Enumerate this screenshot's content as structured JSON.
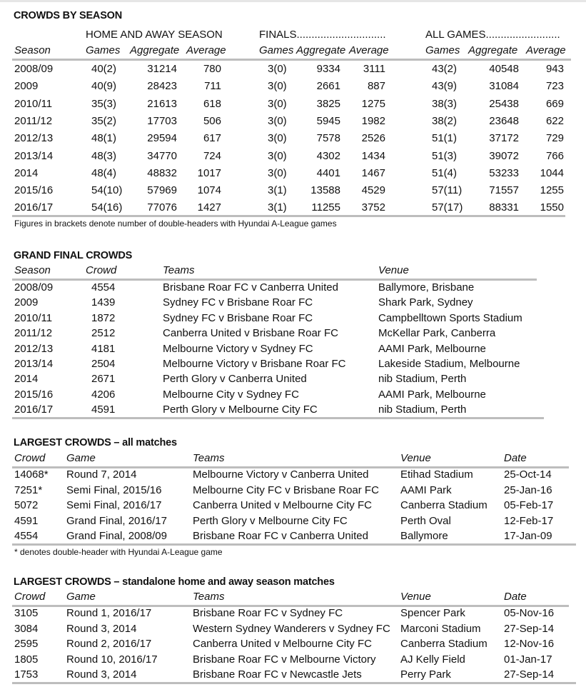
{
  "season": {
    "title": "CROWDS BY SEASON",
    "group_labels": {
      "home_away": "HOME AND AWAY SEASON",
      "finals": "FINALS..............................",
      "all_games": "ALL GAMES........................."
    },
    "headers": {
      "season": "Season",
      "ha_games": "Games",
      "ha_aggregate": "Aggregate",
      "ha_average": "Average",
      "f_games": "Games",
      "f_aggregate": "Aggregate",
      "f_average": "Average",
      "a_games": "Games",
      "a_aggregate": "Aggregate",
      "a_average": "Average"
    },
    "rows": [
      {
        "season": "2008/09",
        "ha_games": "40(2)",
        "ha_aggregate": "31214",
        "ha_average": "780",
        "f_games": "3(0)",
        "f_aggregate": "9334",
        "f_average": "3111",
        "a_games": "43(2)",
        "a_aggregate": "40548",
        "a_average": "943"
      },
      {
        "season": "2009",
        "ha_games": "40(9)",
        "ha_aggregate": "28423",
        "ha_average": "711",
        "f_games": "3(0)",
        "f_aggregate": "2661",
        "f_average": "887",
        "a_games": "43(9)",
        "a_aggregate": "31084",
        "a_average": "723"
      },
      {
        "season": "2010/11",
        "ha_games": "35(3)",
        "ha_aggregate": "21613",
        "ha_average": "618",
        "f_games": "3(0)",
        "f_aggregate": "3825",
        "f_average": "1275",
        "a_games": "38(3)",
        "a_aggregate": "25438",
        "a_average": "669"
      },
      {
        "season": "2011/12",
        "ha_games": "35(2)",
        "ha_aggregate": "17703",
        "ha_average": "506",
        "f_games": "3(0)",
        "f_aggregate": "5945",
        "f_average": "1982",
        "a_games": "38(2)",
        "a_aggregate": "23648",
        "a_average": "622"
      },
      {
        "season": "2012/13",
        "ha_games": "48(1)",
        "ha_aggregate": "29594",
        "ha_average": "617",
        "f_games": "3(0)",
        "f_aggregate": "7578",
        "f_average": "2526",
        "a_games": "51(1)",
        "a_aggregate": "37172",
        "a_average": "729"
      },
      {
        "season": "2013/14",
        "ha_games": "48(3)",
        "ha_aggregate": "34770",
        "ha_average": "724",
        "f_games": "3(0)",
        "f_aggregate": "4302",
        "f_average": "1434",
        "a_games": "51(3)",
        "a_aggregate": "39072",
        "a_average": "766"
      },
      {
        "season": "2014",
        "ha_games": "48(4)",
        "ha_aggregate": "48832",
        "ha_average": "1017",
        "f_games": "3(0)",
        "f_aggregate": "4401",
        "f_average": "1467",
        "a_games": "51(4)",
        "a_aggregate": "53233",
        "a_average": "1044"
      },
      {
        "season": "2015/16",
        "ha_games": "54(10)",
        "ha_aggregate": "57969",
        "ha_average": "1074",
        "f_games": "3(1)",
        "f_aggregate": "13588",
        "f_average": "4529",
        "a_games": "57(11)",
        "a_aggregate": "71557",
        "a_average": "1255"
      },
      {
        "season": "2016/17",
        "ha_games": "54(16)",
        "ha_aggregate": "77076",
        "ha_average": "1427",
        "f_games": "3(1)",
        "f_aggregate": "11255",
        "f_average": "3752",
        "a_games": "57(17)",
        "a_aggregate": "88331",
        "a_average": "1550"
      }
    ],
    "note": "Figures in brackets denote number of double-headers with Hyundai A-League games"
  },
  "grand_final": {
    "title": "GRAND FINAL CROWDS",
    "headers": {
      "season": "Season",
      "crowd": "Crowd",
      "teams": "Teams",
      "venue": "Venue"
    },
    "rows": [
      {
        "season": "2008/09",
        "crowd": "4554",
        "teams": "Brisbane Roar FC v Canberra United",
        "venue": "Ballymore, Brisbane"
      },
      {
        "season": "2009",
        "crowd": "1439",
        "teams": "Sydney FC v Brisbane Roar FC",
        "venue": "Shark Park, Sydney"
      },
      {
        "season": "2010/11",
        "crowd": "1872",
        "teams": "Sydney FC v Brisbane Roar FC",
        "venue": "Campbelltown Sports Stadium"
      },
      {
        "season": "2011/12",
        "crowd": "2512",
        "teams": "Canberra United v Brisbane Roar FC",
        "venue": "McKellar Park, Canberra"
      },
      {
        "season": "2012/13",
        "crowd": "4181",
        "teams": "Melbourne Victory v Sydney FC",
        "venue": "AAMI Park, Melbourne"
      },
      {
        "season": "2013/14",
        "crowd": "2504",
        "teams": "Melbourne Victory v Brisbane Roar FC",
        "venue": "Lakeside Stadium, Melbourne"
      },
      {
        "season": "2014",
        "crowd": "2671",
        "teams": "Perth Glory v Canberra United",
        "venue": "nib Stadium, Perth"
      },
      {
        "season": "2015/16",
        "crowd": "4206",
        "teams": "Melbourne City v Sydney FC",
        "venue": "AAMI Park, Melbourne"
      },
      {
        "season": "2016/17",
        "crowd": "4591",
        "teams": "Perth Glory v Melbourne City FC",
        "venue": "nib Stadium, Perth"
      }
    ]
  },
  "largest_all": {
    "title": "LARGEST CROWDS – all matches",
    "headers": {
      "crowd": "Crowd",
      "game": "Game",
      "teams": "Teams",
      "venue": "Venue",
      "date": "Date"
    },
    "rows": [
      {
        "crowd": "14068*",
        "game": "Round 7, 2014",
        "teams": "Melbourne Victory v Canberra United",
        "venue": "Etihad Stadium",
        "date": "25-Oct-14"
      },
      {
        "crowd": "7251*",
        "game": "Semi Final, 2015/16",
        "teams": "Melbourne City FC v Brisbane Roar FC",
        "venue": "AAMI Park",
        "date": "25-Jan-16"
      },
      {
        "crowd": "5072",
        "game": "Semi Final, 2016/17",
        "teams": "Canberra United v Melbourne City FC",
        "venue": "Canberra Stadium",
        "date": "05-Feb-17"
      },
      {
        "crowd": "4591",
        "game": "Grand Final, 2016/17",
        "teams": "Perth Glory v Melbourne City FC",
        "venue": "Perth Oval",
        "date": "12-Feb-17"
      },
      {
        "crowd": "4554",
        "game": "Grand Final, 2008/09",
        "teams": "Brisbane Roar FC v Canberra United",
        "venue": "Ballymore",
        "date": "17-Jan-09"
      }
    ],
    "note": "* denotes double-header with Hyundai A-League game"
  },
  "largest_standalone": {
    "title": "LARGEST CROWDS – standalone home and away season matches",
    "headers": {
      "crowd": "Crowd",
      "game": "Game",
      "teams": "Teams",
      "venue": "Venue",
      "date": "Date"
    },
    "rows": [
      {
        "crowd": "3105",
        "game": "Round 1, 2016/17",
        "teams": "Brisbane Roar FC v Sydney FC",
        "venue": "Spencer Park",
        "date": "05-Nov-16"
      },
      {
        "crowd": "3084",
        "game": "Round 3, 2014",
        "teams": "Western Sydney Wanderers v Sydney FC",
        "venue": "Marconi Stadium",
        "date": "27-Sep-14"
      },
      {
        "crowd": "2595",
        "game": "Round 2, 2016/17",
        "teams": "Canberra United v Melbourne City FC",
        "venue": "Canberra Stadium",
        "date": "12-Nov-16"
      },
      {
        "crowd": "1805",
        "game": "Round 10, 2016/17",
        "teams": "Brisbane Roar FC v Melbourne Victory",
        "venue": "AJ Kelly Field",
        "date": "01-Jan-17"
      },
      {
        "crowd": "1753",
        "game": "Round 3, 2014",
        "teams": "Brisbane Roar FC v Newcastle Jets",
        "venue": "Perry Park",
        "date": "27-Sep-14"
      }
    ]
  }
}
